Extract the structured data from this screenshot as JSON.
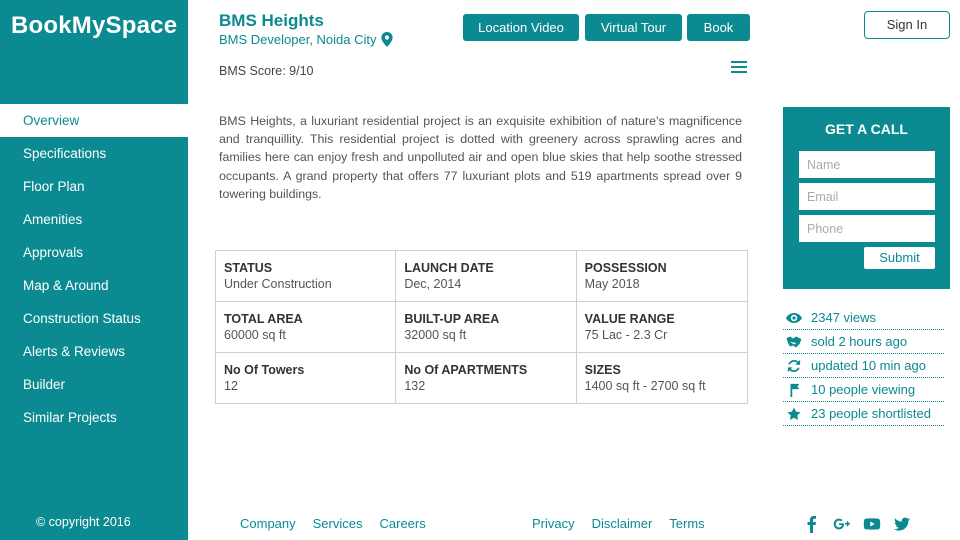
{
  "brand": "BookMySpace",
  "project": {
    "title": "BMS Heights",
    "subtitle": "BMS Developer, Noida City",
    "score": "BMS Score: 9/10"
  },
  "header": {
    "location_video": "Location Video",
    "virtual_tour": "Virtual Tour",
    "book": "Book",
    "sign_in": "Sign In"
  },
  "nav": [
    "Overview",
    "Specifications",
    "Floor Plan",
    "Amenities",
    "Approvals",
    "Map & Around",
    "Construction Status",
    "Alerts & Reviews",
    "Builder",
    "Similar Projects"
  ],
  "description": "BMS Heights, a luxuriant residential project is an exquisite exhibition of nature's magnificence and tranquillity. This residential project is dotted with greenery across sprawling acres and families here can enjoy fresh and unpolluted air and open blue skies that help soothe stressed occupants. A grand property that offers 77 luxuriant plots and 519 apartments spread over 9 towering buildings.",
  "facts": [
    [
      {
        "label": "STATUS",
        "value": "Under Construction"
      },
      {
        "label": "LAUNCH DATE",
        "value": "Dec, 2014"
      },
      {
        "label": "POSSESSION",
        "value": "May 2018"
      }
    ],
    [
      {
        "label": "TOTAL AREA",
        "value": "60000 sq ft"
      },
      {
        "label": "BUILT-UP AREA",
        "value": "32000 sq ft"
      },
      {
        "label": "VALUE RANGE",
        "value": "75 Lac - 2.3 Cr"
      }
    ],
    [
      {
        "label": "No Of Towers",
        "value": "12"
      },
      {
        "label": "No Of APARTMENTS",
        "value": "132"
      },
      {
        "label": "SIZES",
        "value": "1400 sq ft - 2700 sq ft"
      }
    ]
  ],
  "call": {
    "title": "GET A CALL",
    "name_placeholder": "Name",
    "email_placeholder": "Email",
    "phone_placeholder": "Phone",
    "submit": "Submit"
  },
  "stats": [
    {
      "icon": "eye-icon",
      "text": "2347 views"
    },
    {
      "icon": "handshake-icon",
      "text": "sold 2 hours ago"
    },
    {
      "icon": "refresh-icon",
      "text": "updated 10 min ago"
    },
    {
      "icon": "people-icon",
      "text": "10 people viewing"
    },
    {
      "icon": "star-icon",
      "text": "23 people shortlisted"
    }
  ],
  "footer": {
    "copyright": "© copyright 2016",
    "left_links": [
      "Company",
      "Services",
      "Careers"
    ],
    "right_links": [
      "Privacy",
      "Disclaimer",
      "Terms"
    ],
    "social": [
      "facebook-icon",
      "google-plus-icon",
      "youtube-icon",
      "twitter-icon"
    ]
  },
  "colors": {
    "accent": "#0b8a92",
    "text": "#444444"
  }
}
